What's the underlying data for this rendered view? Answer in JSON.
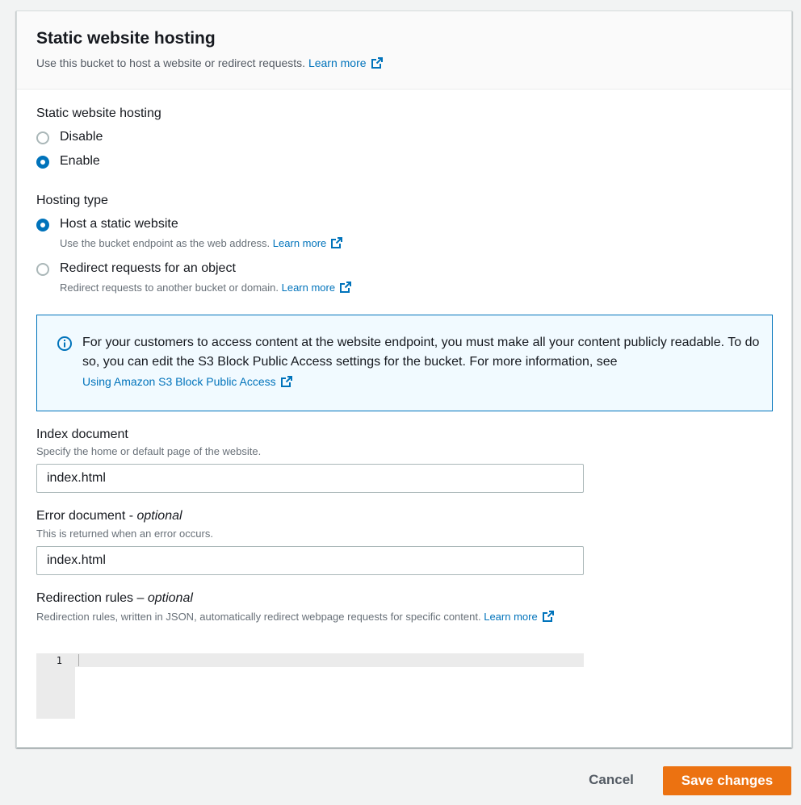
{
  "header": {
    "title": "Static website hosting",
    "description": "Use this bucket to host a website or redirect requests.",
    "learn_more": "Learn more"
  },
  "hosting": {
    "label": "Static website hosting",
    "options": [
      {
        "label": "Disable",
        "checked": false
      },
      {
        "label": "Enable",
        "checked": true
      }
    ]
  },
  "hosting_type": {
    "label": "Hosting type",
    "options": [
      {
        "label": "Host a static website",
        "description": "Use the bucket endpoint as the web address.",
        "learn_more": "Learn more",
        "checked": true
      },
      {
        "label": "Redirect requests for an object",
        "description": "Redirect requests to another bucket or domain.",
        "learn_more": "Learn more",
        "checked": false
      }
    ]
  },
  "info": {
    "text": "For your customers to access content at the website endpoint, you must make all your content publicly readable. To do so, you can edit the S3 Block Public Access settings for the bucket. For more information, see",
    "link": "Using Amazon S3 Block Public Access",
    "icon": "info-icon"
  },
  "index_document": {
    "label": "Index document",
    "description": "Specify the home or default page of the website.",
    "value": "index.html"
  },
  "error_document": {
    "label": "Error document -",
    "optional": "optional",
    "description": "This is returned when an error occurs.",
    "value": "index.html"
  },
  "redirection_rules": {
    "label": "Redirection rules –",
    "optional": "optional",
    "description": "Redirection rules, written in JSON, automatically redirect webpage requests for specific content.",
    "learn_more": "Learn more",
    "line_number": "1"
  },
  "footer": {
    "cancel": "Cancel",
    "save": "Save changes"
  },
  "colors": {
    "accent": "#0073bb",
    "primary_button": "#ec7211",
    "info_bg": "#f1faff"
  }
}
